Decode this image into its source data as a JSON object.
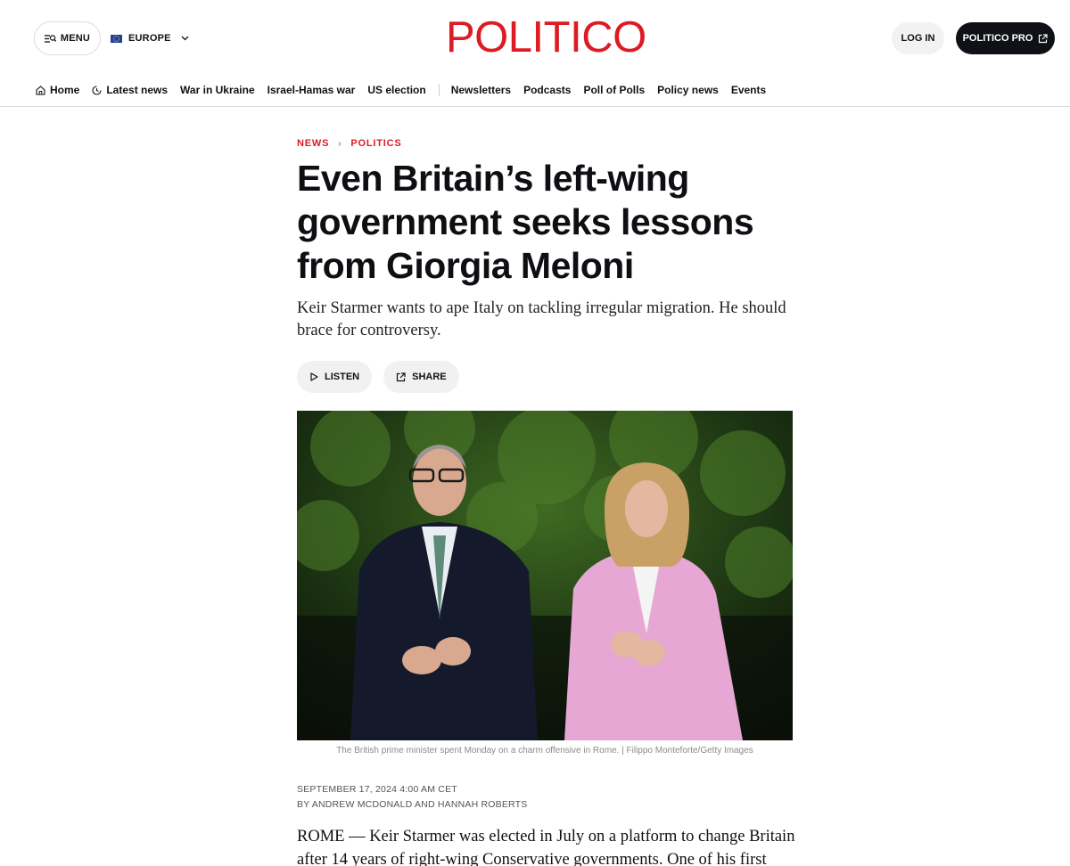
{
  "header": {
    "menu_label": "MENU",
    "edition_label": "EUROPE",
    "logo_text": "POLITICO",
    "login_label": "LOG IN",
    "pro_label": "POLITICO PRO",
    "brand_color": "#dc1b25"
  },
  "nav": {
    "home": "Home",
    "latest": "Latest news",
    "ukraine": "War in Ukraine",
    "israel": "Israel-Hamas war",
    "us": "US election",
    "newsletters": "Newsletters",
    "podcasts": "Podcasts",
    "poll": "Poll of Polls",
    "policy": "Policy news",
    "events": "Events"
  },
  "article": {
    "crumb_1": "NEWS",
    "crumb_2": "POLITICS",
    "headline": "Even Britain’s left-wing government seeks lessons from Giorgia Meloni",
    "dek": "Keir Starmer wants to ape Italy on tackling irregular migration. He should brace for controversy.",
    "listen_label": "LISTEN",
    "share_label": "SHARE",
    "caption": "The British prime minister spent Monday on a charm offensive in Rome. | Filippo Monteforte/Getty Images",
    "date": "SEPTEMBER 17, 2024 4:00 AM CET",
    "byline": "BY ANDREW MCDONALD AND HANNAH ROBERTS",
    "body": "ROME — Keir Starmer was elected in July on a platform to change Britain after 14 years of right-wing Conservative governments. One of his first steps as"
  }
}
